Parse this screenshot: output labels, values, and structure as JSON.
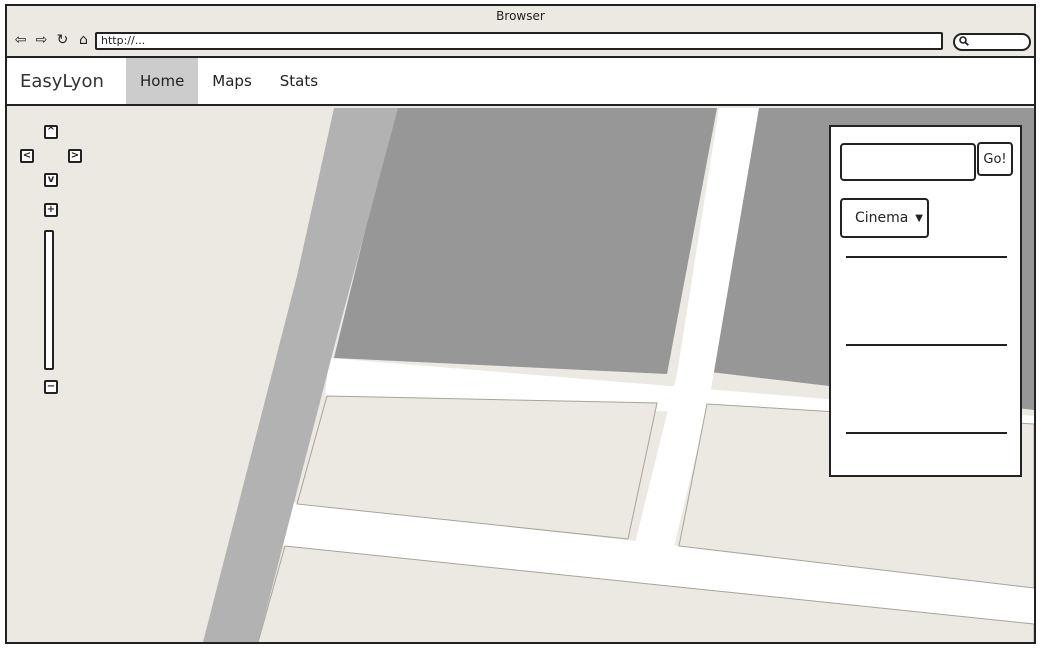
{
  "browser": {
    "title": "Browser",
    "address": "http://...",
    "nav_icons": [
      "back-arrow-icon",
      "forward-arrow-icon",
      "reload-icon",
      "home-icon"
    ],
    "search_icon": "search-icon"
  },
  "app": {
    "brand": "EasyLyon",
    "menu": [
      {
        "label": "Home",
        "active": true
      },
      {
        "label": "Maps",
        "active": false
      },
      {
        "label": "Stats",
        "active": false
      }
    ]
  },
  "map_controls": {
    "pan_up": "^",
    "pan_left": "<",
    "pan_right": ">",
    "pan_down": "v",
    "zoom_in": "+",
    "zoom_out": "−"
  },
  "panel": {
    "search_value": "",
    "go_label": "Go!",
    "category": "Cinema",
    "results": [
      "",
      "",
      ""
    ]
  },
  "colors": {
    "land": "#ece9e2",
    "road": "#ffffff",
    "building": "#979797",
    "river": "#b2b2b2",
    "active_tab": "#cccccc"
  }
}
